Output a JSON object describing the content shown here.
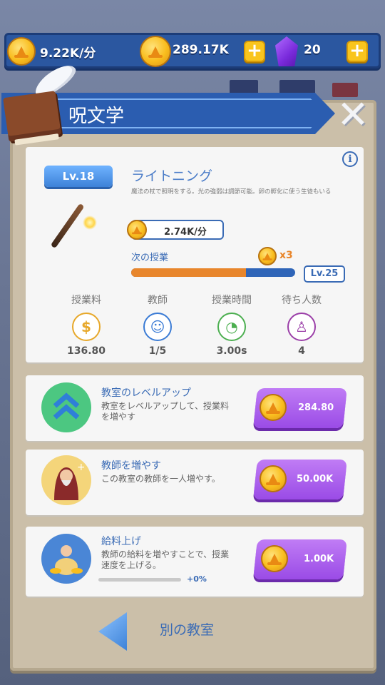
{
  "topbar": {
    "income_rate": "9.22K/分",
    "coins": "289.17K",
    "gems": "20",
    "plus_label": "+"
  },
  "header": {
    "title": "呪文学",
    "close_label": "✕"
  },
  "skill": {
    "level": "Lv.18",
    "name": "ライトニング",
    "description": "魔法の杖で照明をする。光の強弱は調節可能。卵の孵化に使う生徒もいる",
    "rate": "2.74K/分",
    "next_label": "次の授業",
    "multiplier": "x3",
    "next_level": "Lv.25",
    "progress": 0.7,
    "info_label": "i"
  },
  "stats": [
    {
      "label": "授業料",
      "value": "136.80",
      "icon": "dollar-icon",
      "glyph": "$",
      "color": "#e7a82a"
    },
    {
      "label": "教師",
      "value": "1/5",
      "icon": "teacher-icon",
      "glyph": "☺",
      "color": "#3a7bd5"
    },
    {
      "label": "授業時間",
      "value": "3.00s",
      "icon": "clock-icon",
      "glyph": "◔",
      "color": "#4caf50"
    },
    {
      "label": "待ち人数",
      "value": "4",
      "icon": "person-icon",
      "glyph": "♙",
      "color": "#9b3fa8"
    }
  ],
  "upgrades": [
    {
      "title": "教室のレベルアップ",
      "desc1": "教室をレベルアップして、授業料",
      "desc2": "を増やす",
      "price": "284.80"
    },
    {
      "title": "教師を増やす",
      "desc1": "この教室の教師を一人増やす。",
      "desc2": "",
      "price": "50.00K"
    },
    {
      "title": "給料上げ",
      "desc1": "教師の給料を増やすことで、授業",
      "desc2": "速度を上げる。",
      "price": "1.00K",
      "bonus": "+0%"
    }
  ],
  "footer": {
    "back_label": "別の教室"
  },
  "colors": {
    "accent_blue": "#3a6bb5",
    "orange": "#e8862c",
    "purple": "#9a4be6",
    "gold": "#f9bd1d"
  }
}
